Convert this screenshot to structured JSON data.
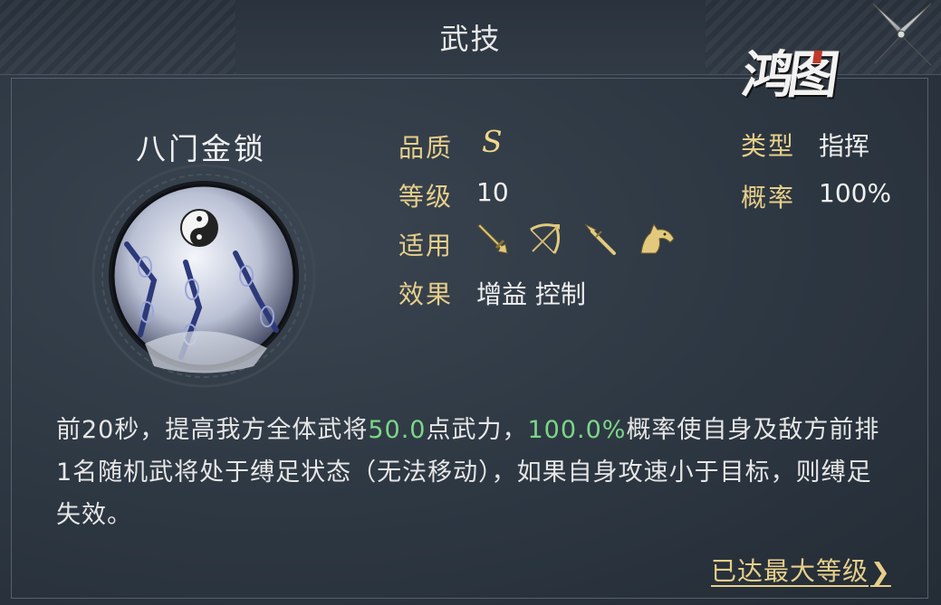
{
  "header": {
    "title": "武技"
  },
  "logo": {
    "text": "鸿图"
  },
  "skill": {
    "name": "八门金锁",
    "quality_label": "品质",
    "quality_value": "S",
    "level_label": "等级",
    "level_value": "10",
    "applicable_label": "适用",
    "applicable_icons": [
      "sword-icon",
      "bow-icon",
      "spear-icon",
      "horse-icon"
    ],
    "effect_label": "效果",
    "effect_value": "增益 控制",
    "type_label": "类型",
    "type_value": "指挥",
    "rate_label": "概率",
    "rate_value": "100%"
  },
  "description": {
    "part1": "前20秒，提高我方全体武将",
    "value1": "50.0",
    "part2": "点武力，",
    "value2": "100.0%",
    "part3": "概率使自身及敌方前排1名随机武将处于缚足状态（无法移动），如果自身攻速小于目标，则缚足失效。"
  },
  "footer": {
    "max_level_label": "已达最大等级"
  },
  "colors": {
    "gold": "#e7cf8a",
    "highlight": "#7dd68a",
    "bg": "#2d3742"
  }
}
